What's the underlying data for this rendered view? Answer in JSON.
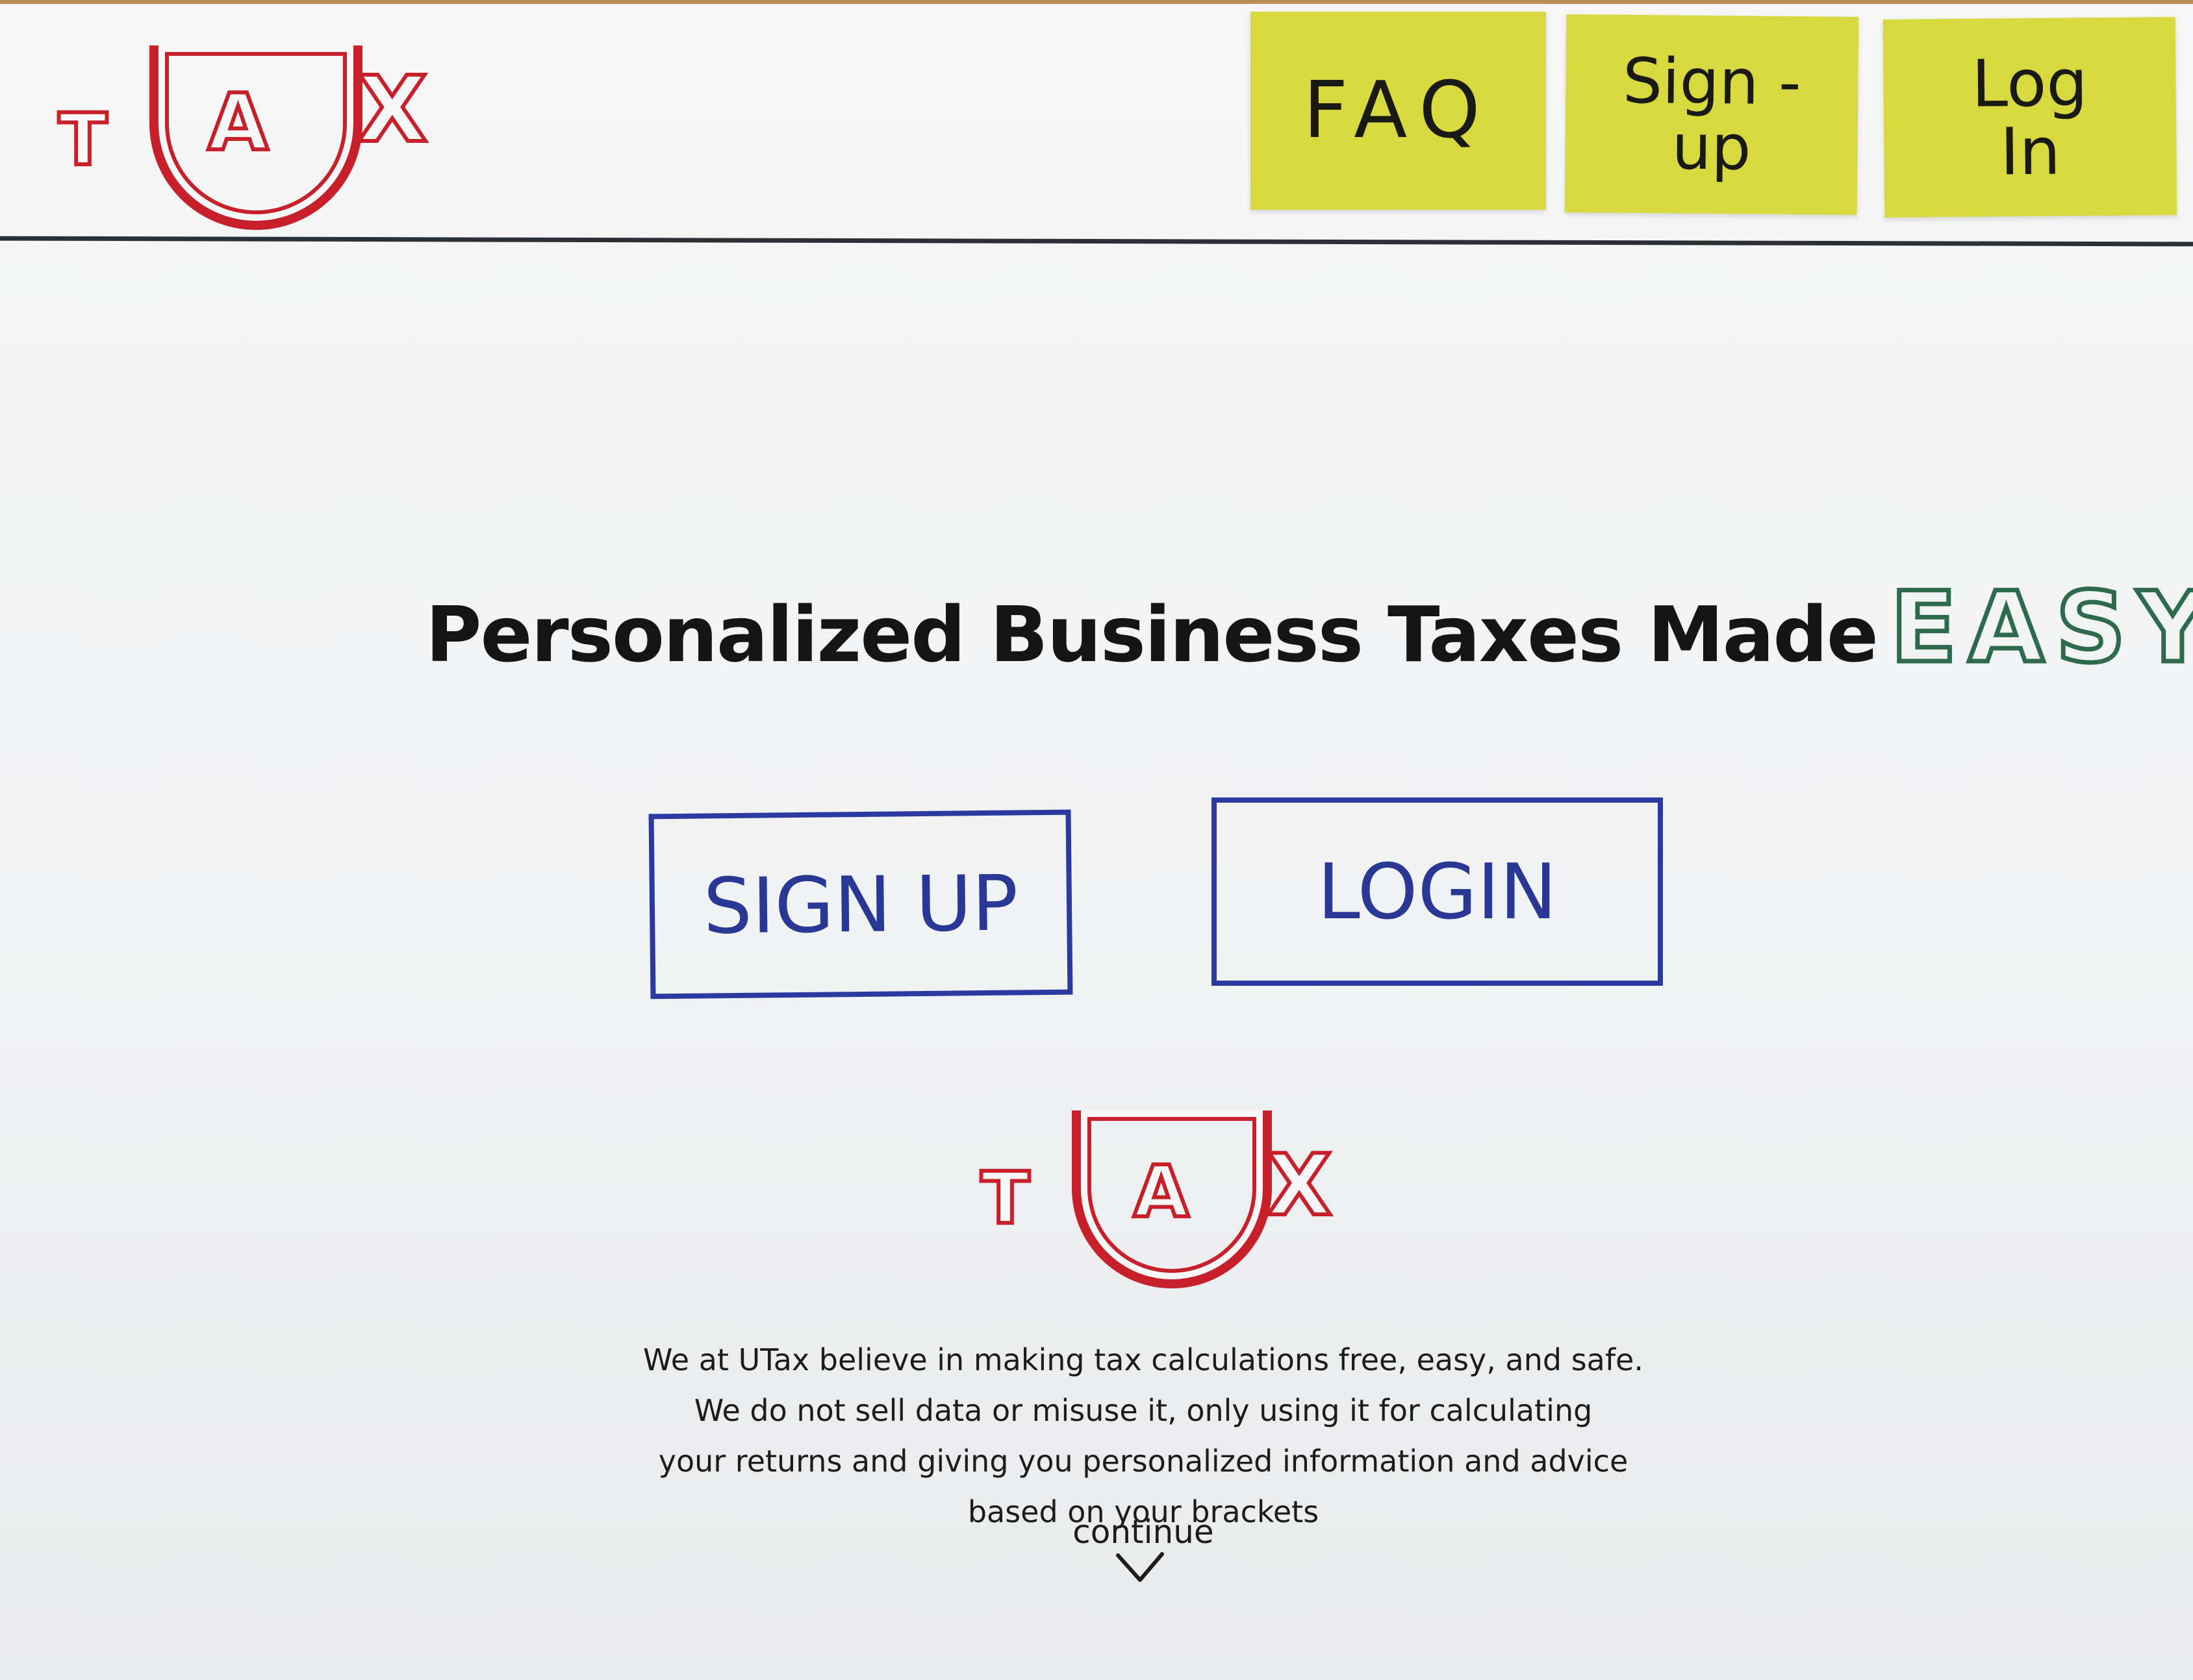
{
  "brand": {
    "logo_letters": [
      "T",
      "U",
      "A",
      "X"
    ],
    "logo_color": "#c8202b"
  },
  "nav": {
    "items": [
      {
        "label": "FAQ"
      },
      {
        "label": "Sign -\nup"
      },
      {
        "label": "Log\nIn"
      }
    ],
    "sticky_color": "#d8d93e"
  },
  "hero": {
    "headline": "Personalized Business Taxes Made",
    "accent": "EASY.",
    "accent_color": "#2e6b4c"
  },
  "actions": {
    "signup_label": "SIGN UP",
    "login_label": "LOGIN",
    "button_color": "#2b3aa0"
  },
  "footer": {
    "statement_lines": [
      "We at UTax believe in making tax calculations free, easy, and safe.",
      "We do not sell data or misuse it, only using it for calculating",
      "your returns and giving you personalized information and advice",
      "based on your brackets"
    ],
    "continue_label": "continue",
    "continue_icon": "chevron-down-icon"
  }
}
